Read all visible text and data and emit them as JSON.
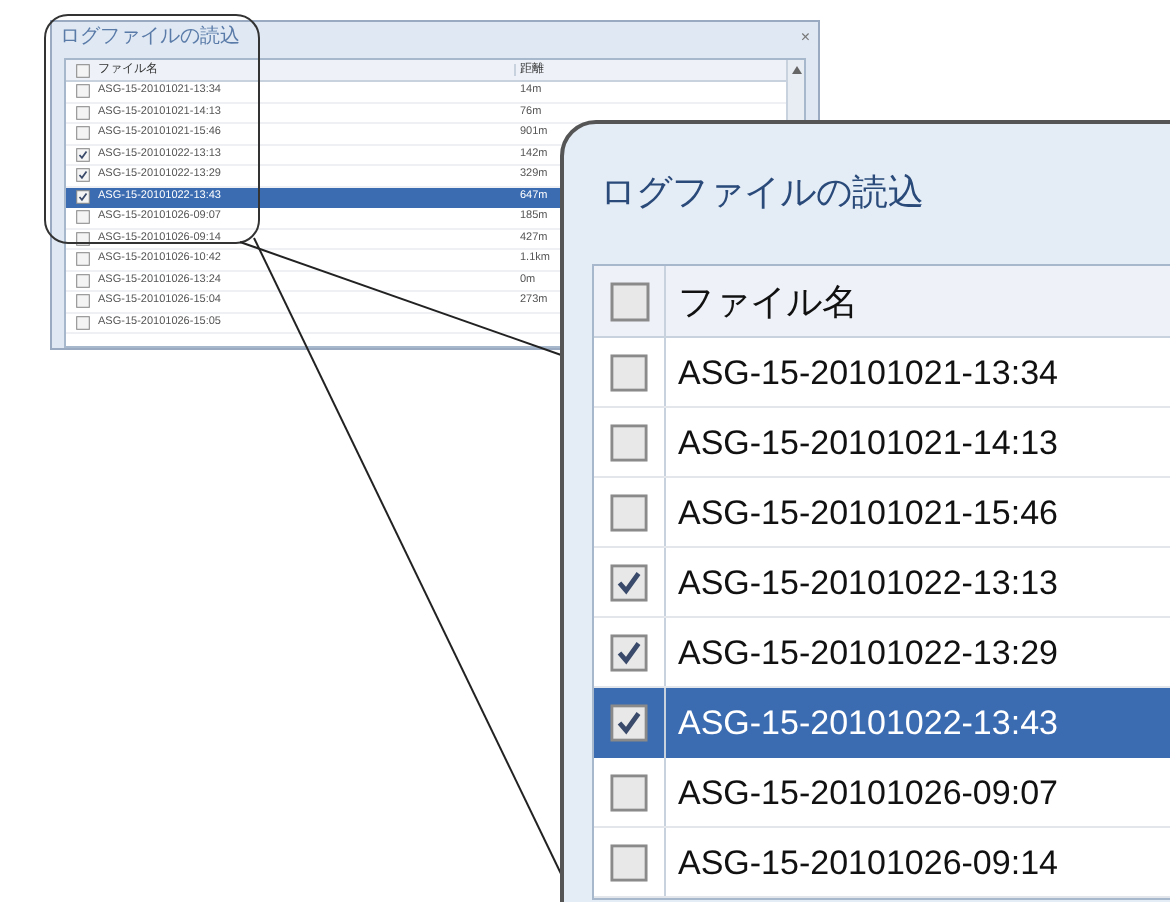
{
  "small_window": {
    "title": "ログファイルの読込",
    "close": "×",
    "columns": [
      "ファイル名",
      "距離"
    ],
    "header_checked": false,
    "rows": [
      {
        "name": "ASG-15-20101021-13:34",
        "distance": "14m",
        "checked": false,
        "selected": false
      },
      {
        "name": "ASG-15-20101021-14:13",
        "distance": "76m",
        "checked": false,
        "selected": false
      },
      {
        "name": "ASG-15-20101021-15:46",
        "distance": "901m",
        "checked": false,
        "selected": false
      },
      {
        "name": "ASG-15-20101022-13:13",
        "distance": "142m",
        "checked": true,
        "selected": false
      },
      {
        "name": "ASG-15-20101022-13:29",
        "distance": "329m",
        "checked": true,
        "selected": false
      },
      {
        "name": "ASG-15-20101022-13:43",
        "distance": "647m",
        "checked": true,
        "selected": true
      },
      {
        "name": "ASG-15-20101026-09:07",
        "distance": "185m",
        "checked": false,
        "selected": false
      },
      {
        "name": "ASG-15-20101026-09:14",
        "distance": "427m",
        "checked": false,
        "selected": false
      },
      {
        "name": "ASG-15-20101026-10:42",
        "distance": "1.1km",
        "checked": false,
        "selected": false
      },
      {
        "name": "ASG-15-20101026-13:24",
        "distance": "0m",
        "checked": false,
        "selected": false
      },
      {
        "name": "ASG-15-20101026-15:04",
        "distance": "273m",
        "checked": false,
        "selected": false
      },
      {
        "name": "ASG-15-20101026-15:05",
        "checked": false,
        "selected": false
      }
    ]
  },
  "callout": {
    "title": "ログファイルの読込",
    "column": "ファイル名",
    "header_checked": false,
    "rows": [
      {
        "name": "ASG-15-20101021-13:34",
        "checked": false,
        "selected": false
      },
      {
        "name": "ASG-15-20101021-14:13",
        "checked": false,
        "selected": false
      },
      {
        "name": "ASG-15-20101021-15:46",
        "checked": false,
        "selected": false
      },
      {
        "name": "ASG-15-20101022-13:13",
        "checked": true,
        "selected": false
      },
      {
        "name": "ASG-15-20101022-13:29",
        "checked": true,
        "selected": false
      },
      {
        "name": "ASG-15-20101022-13:43",
        "checked": true,
        "selected": true
      },
      {
        "name": "ASG-15-20101026-09:07",
        "checked": false,
        "selected": false
      },
      {
        "name": "ASG-15-20101026-09:14",
        "checked": false,
        "selected": false
      }
    ]
  }
}
